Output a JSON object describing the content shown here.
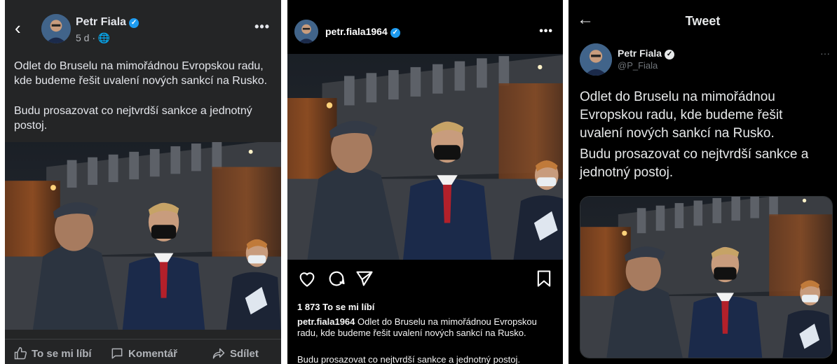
{
  "facebook": {
    "back_icon": "chevron-left-icon",
    "author": "Petr Fiala",
    "meta": "5 d · 🌐",
    "more": "•••",
    "text_p1": "Odlet do Bruselu na mimořádnou Evropskou radu, kde budeme řešit uvalení nových sankcí na Rusko.",
    "text_p2": "Budu prosazovat co nejtvrdší sankce a jednotný postoj.",
    "actions": {
      "like": "To se mi líbí",
      "comment": "Komentář",
      "share": "Sdílet"
    }
  },
  "instagram": {
    "username": "petr.fiala1964",
    "more": "•••",
    "likes": "1 873 To se mi líbí",
    "caption_user": "petr.fiala1964",
    "caption_p1": "Odlet do Bruselu na mimořádnou Evropskou radu, kde budeme řešit uvalení nových sankcí na Rusko.",
    "caption_p2": "Budu prosazovat co nejtvrdší sankce a jednotný postoj."
  },
  "twitter": {
    "back": "←",
    "header_title": "Tweet",
    "name": "Petr Fiala",
    "handle": "@P_Fiala",
    "more": "···",
    "text_p1": "Odlet do Bruselu na mimořádnou Evropskou radu, kde budeme řešit uvalení nových sankcí na Rusko.",
    "text_p2": "Budu prosazovat co nejtvrdší sankce a jednotný postoj."
  },
  "colors": {
    "facebook_bg": "#242526",
    "verified_blue": "#1d9bf0",
    "tie_red": "#b3202a"
  }
}
